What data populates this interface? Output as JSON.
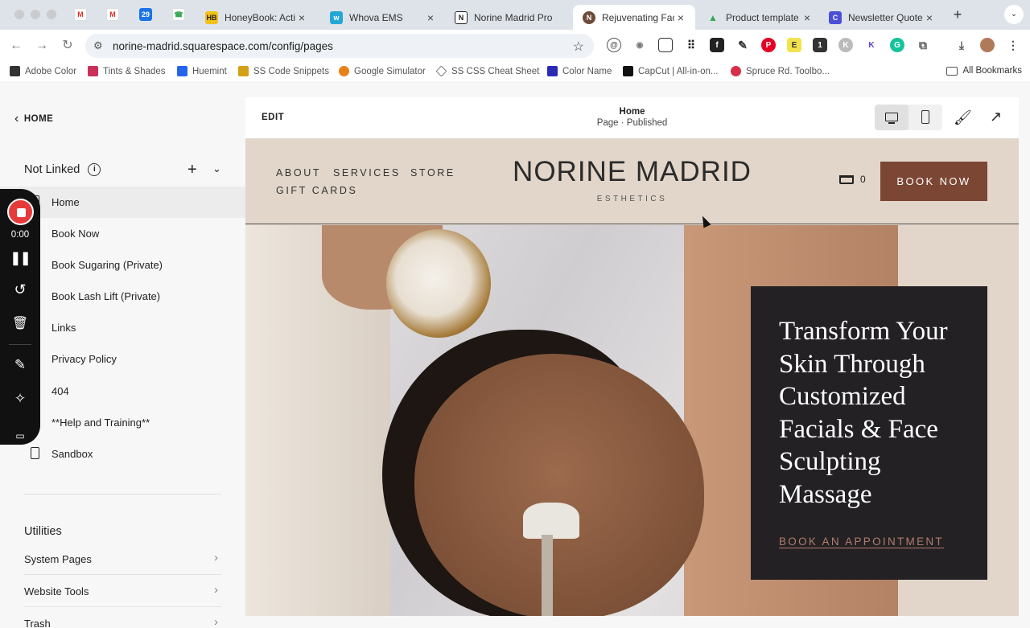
{
  "browser": {
    "tabs": [
      {
        "title": "HoneyBook: Activ",
        "icon": "honeybook-icon",
        "color": "#f2c21b"
      },
      {
        "title": "Whova EMS",
        "icon": "whova-icon",
        "color": "#25a7d6"
      },
      {
        "title": "Norine Madrid Pro",
        "icon": "notion-icon",
        "color": "#222222"
      },
      {
        "title": "Rejuvenating Faci",
        "icon": "norine-madrid-icon",
        "color": "#6e4a3a"
      },
      {
        "title": "Product template",
        "icon": "google-drive-icon",
        "color": "#34a853"
      },
      {
        "title": "Newsletter Quote",
        "icon": "canva-icon",
        "color": "#4a4ed8"
      }
    ],
    "url": "norine-madrid.squarespace.com/config/pages",
    "bookmarks": [
      {
        "label": "Adobe Color",
        "color": "#333333"
      },
      {
        "label": "Tints & Shades",
        "color": "#c9305a"
      },
      {
        "label": "Huemint",
        "color": "#2563eb"
      },
      {
        "label": "SS Code Snippets",
        "color": "#d4a017"
      },
      {
        "label": "Google Simulator",
        "color": "#e8811a"
      },
      {
        "label": "SS CSS Cheat Sheet",
        "color": "#777777"
      },
      {
        "label": "Color Name",
        "color": "#2b2bb5"
      },
      {
        "label": "CapCut | All-in-on...",
        "color": "#111111"
      },
      {
        "label": "Spruce Rd. Toolbo...",
        "color": "#d8304a"
      }
    ],
    "all_bookmarks": "All Bookmarks"
  },
  "sidebar": {
    "back_label": "HOME",
    "section_title": "Not Linked",
    "info_symbol": "i",
    "add_symbol": "+",
    "collapse_symbol": "⌄",
    "pages": [
      {
        "label": "Home",
        "selected": true
      },
      {
        "label": "Book Now"
      },
      {
        "label": "Book Sugaring (Private)"
      },
      {
        "label": "Book Lash Lift (Private)"
      },
      {
        "label": "Links"
      },
      {
        "label": "Privacy Policy"
      },
      {
        "label": "404"
      },
      {
        "label": "**Help and Training**"
      },
      {
        "label": "Sandbox"
      }
    ],
    "utilities_title": "Utilities",
    "utilities": [
      {
        "label": "System Pages"
      },
      {
        "label": "Website Tools"
      },
      {
        "label": "Trash"
      }
    ]
  },
  "recorder": {
    "time": "0:00"
  },
  "editor": {
    "edit_label": "EDIT",
    "page_name": "Home",
    "page_status": "Page · Published"
  },
  "site": {
    "nav": [
      "ABOUT",
      "SERVICES",
      "STORE",
      "GIFT CARDS"
    ],
    "brand": "NORINE MADRID",
    "brand_sub": "ESTHETICS",
    "cart_count": "0",
    "book_button": "BOOK NOW",
    "hero_title": "Transform Your Skin Through Customized Facials & Face Sculpting Massage",
    "hero_cta": "BOOK AN APPOINTMENT",
    "colors": {
      "header_bg": "#e1d6c9",
      "book_button": "#7b4634",
      "overlay": "#232124",
      "cta": "#b27d6d"
    }
  }
}
